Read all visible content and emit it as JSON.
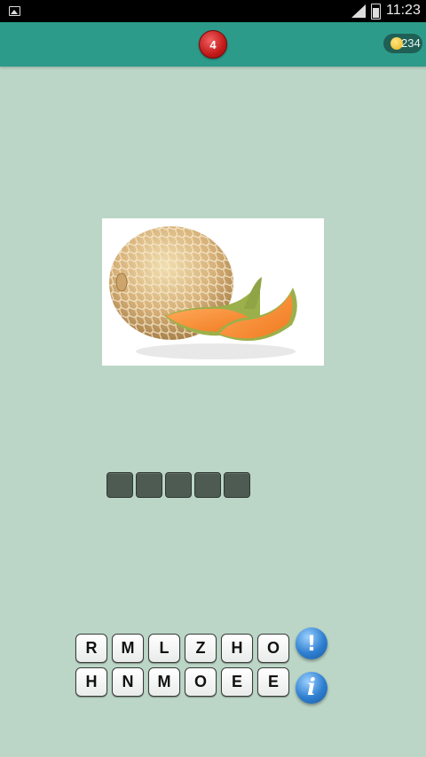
{
  "status_bar": {
    "time": "11:23"
  },
  "header": {
    "level": "4",
    "coins": "234"
  },
  "puzzle": {
    "image_icon": "cantaloupe-melon-image",
    "answer_slots": 5
  },
  "letters": {
    "row1": [
      "R",
      "M",
      "L",
      "Z",
      "H",
      "O"
    ],
    "row2": [
      "H",
      "N",
      "M",
      "O",
      "E",
      "E"
    ]
  },
  "actions": {
    "hint_symbol": "!",
    "info_symbol": "i"
  },
  "colors": {
    "background": "#bbd6c6",
    "header": "#2d9b8a",
    "answer_slot": "#4e5b52",
    "level_badge": "#c21a1a",
    "action_button": "#2f7fd0"
  }
}
